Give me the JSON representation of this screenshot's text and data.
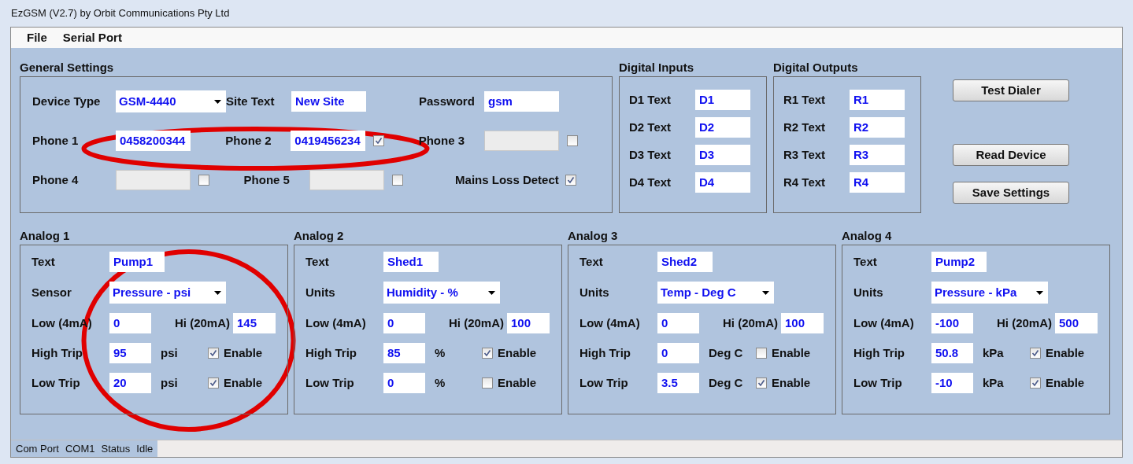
{
  "window": {
    "title": "EzGSM (V2.7) by Orbit Communications Pty Ltd"
  },
  "menu": [
    "File",
    "Serial Port"
  ],
  "general": {
    "title": "General Settings",
    "rows": [
      [
        {
          "kind": "dropdown",
          "label": "Device Type",
          "value": "GSM-4440"
        },
        {
          "kind": "text",
          "label": "Site Text",
          "value": "New Site"
        },
        {
          "kind": "text",
          "label": "Password",
          "value": "gsm"
        }
      ],
      [
        {
          "kind": "text",
          "label": "Phone 1",
          "value": "0458200344"
        },
        {
          "kind": "text_check",
          "label": "Phone  2",
          "value": "0419456234",
          "disabled": false,
          "checked": true
        },
        {
          "kind": "text_check",
          "label": "Phone 3",
          "disabled": true,
          "checked": false
        }
      ],
      [
        {
          "kind": "text_check",
          "label": "Phone 4",
          "disabled": true,
          "checked": false
        },
        {
          "kind": "text_check",
          "label": "Phone 5",
          "disabled": true,
          "checked": false
        },
        {
          "kind": "check",
          "label": "Mains Loss Detect",
          "checked": true
        }
      ]
    ]
  },
  "digital_inputs": {
    "title": "Digital Inputs",
    "rows": [
      {
        "label": "D1 Text",
        "value": "D1"
      },
      {
        "label": "D2 Text",
        "value": "D2"
      },
      {
        "label": "D3 Text",
        "value": "D3"
      },
      {
        "label": "D4 Text",
        "value": "D4"
      }
    ]
  },
  "digital_outputs": {
    "title": "Digital Outputs",
    "rows": [
      {
        "label": "R1 Text",
        "value": "R1"
      },
      {
        "label": "R2 Text",
        "value": "R2"
      },
      {
        "label": "R3 Text",
        "value": "R3"
      },
      {
        "label": "R4 Text",
        "value": "R4"
      }
    ]
  },
  "buttons": [
    "Test Dialer",
    "Read Device",
    "Save Settings"
  ],
  "analogs": [
    {
      "title": "Analog 1",
      "text": {
        "label": "Text",
        "value": "Pump1"
      },
      "units": {
        "label": "Sensor",
        "value": "Pressure - psi"
      },
      "low": {
        "label": "Low (4mA)",
        "value": "0"
      },
      "hi": {
        "label": "Hi (20mA)",
        "value": "145"
      },
      "trips": [
        {
          "label": "High Trip",
          "value": "95",
          "unit": "psi",
          "enable": "Enable",
          "checked": true
        },
        {
          "label": "Low Trip",
          "value": "20",
          "unit": "psi",
          "enable": "Enable",
          "checked": true
        }
      ]
    },
    {
      "title": "Analog 2",
      "text": {
        "label": "Text",
        "value": "Shed1"
      },
      "units": {
        "label": "Units",
        "value": "Humidity - %"
      },
      "low": {
        "label": "Low (4mA)",
        "value": "0"
      },
      "hi": {
        "label": "Hi (20mA)",
        "value": "100"
      },
      "trips": [
        {
          "label": "High Trip",
          "value": "85",
          "unit": "%",
          "enable": "Enable",
          "checked": true
        },
        {
          "label": "Low Trip",
          "value": "0",
          "unit": "%",
          "enable": "Enable",
          "checked": false
        }
      ]
    },
    {
      "title": "Analog 3",
      "text": {
        "label": "Text",
        "value": "Shed2"
      },
      "units": {
        "label": "Units",
        "value": "Temp - Deg C"
      },
      "low": {
        "label": "Low (4mA)",
        "value": "0"
      },
      "hi": {
        "label": "Hi (20mA)",
        "value": "100"
      },
      "trips": [
        {
          "label": "High Trip",
          "value": "0",
          "unit": "Deg C",
          "enable": "Enable",
          "checked": false
        },
        {
          "label": "Low Trip",
          "value": "3.5",
          "unit": "Deg C",
          "enable": "Enable",
          "checked": true
        }
      ]
    },
    {
      "title": "Analog 4",
      "text": {
        "label": "Text",
        "value": "Pump2"
      },
      "units": {
        "label": "Units",
        "value": "Pressure - kPa"
      },
      "low": {
        "label": "Low (4mA)",
        "value": "-100"
      },
      "hi": {
        "label": "Hi (20mA)",
        "value": "500"
      },
      "trips": [
        {
          "label": "High Trip",
          "value": "50.8",
          "unit": "kPa",
          "enable": "Enable",
          "checked": true
        },
        {
          "label": "Low Trip",
          "value": "-10",
          "unit": "kPa",
          "enable": "Enable",
          "checked": true
        }
      ]
    }
  ],
  "status_bar": [
    "Com Port",
    "COM1",
    "Status",
    "Idle"
  ],
  "annotations": [
    {
      "kind": "ellipse"
    },
    {
      "kind": "ellipse"
    }
  ]
}
